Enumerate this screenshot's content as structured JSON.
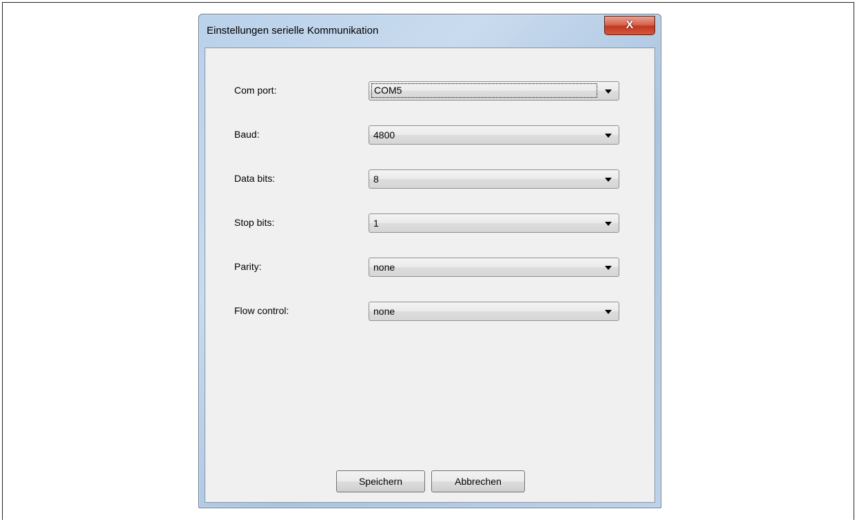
{
  "window": {
    "title": "Einstellungen serielle Kommunikation",
    "close_label": "X"
  },
  "fields": [
    {
      "label": "Com port:",
      "value": "COM5"
    },
    {
      "label": "Baud:",
      "value": "4800"
    },
    {
      "label": "Data bits:",
      "value": "8"
    },
    {
      "label": "Stop bits:",
      "value": "1"
    },
    {
      "label": "Parity:",
      "value": "none"
    },
    {
      "label": "Flow control:",
      "value": "none"
    }
  ],
  "buttons": {
    "save": "Speichern",
    "cancel": "Abbrechen"
  }
}
